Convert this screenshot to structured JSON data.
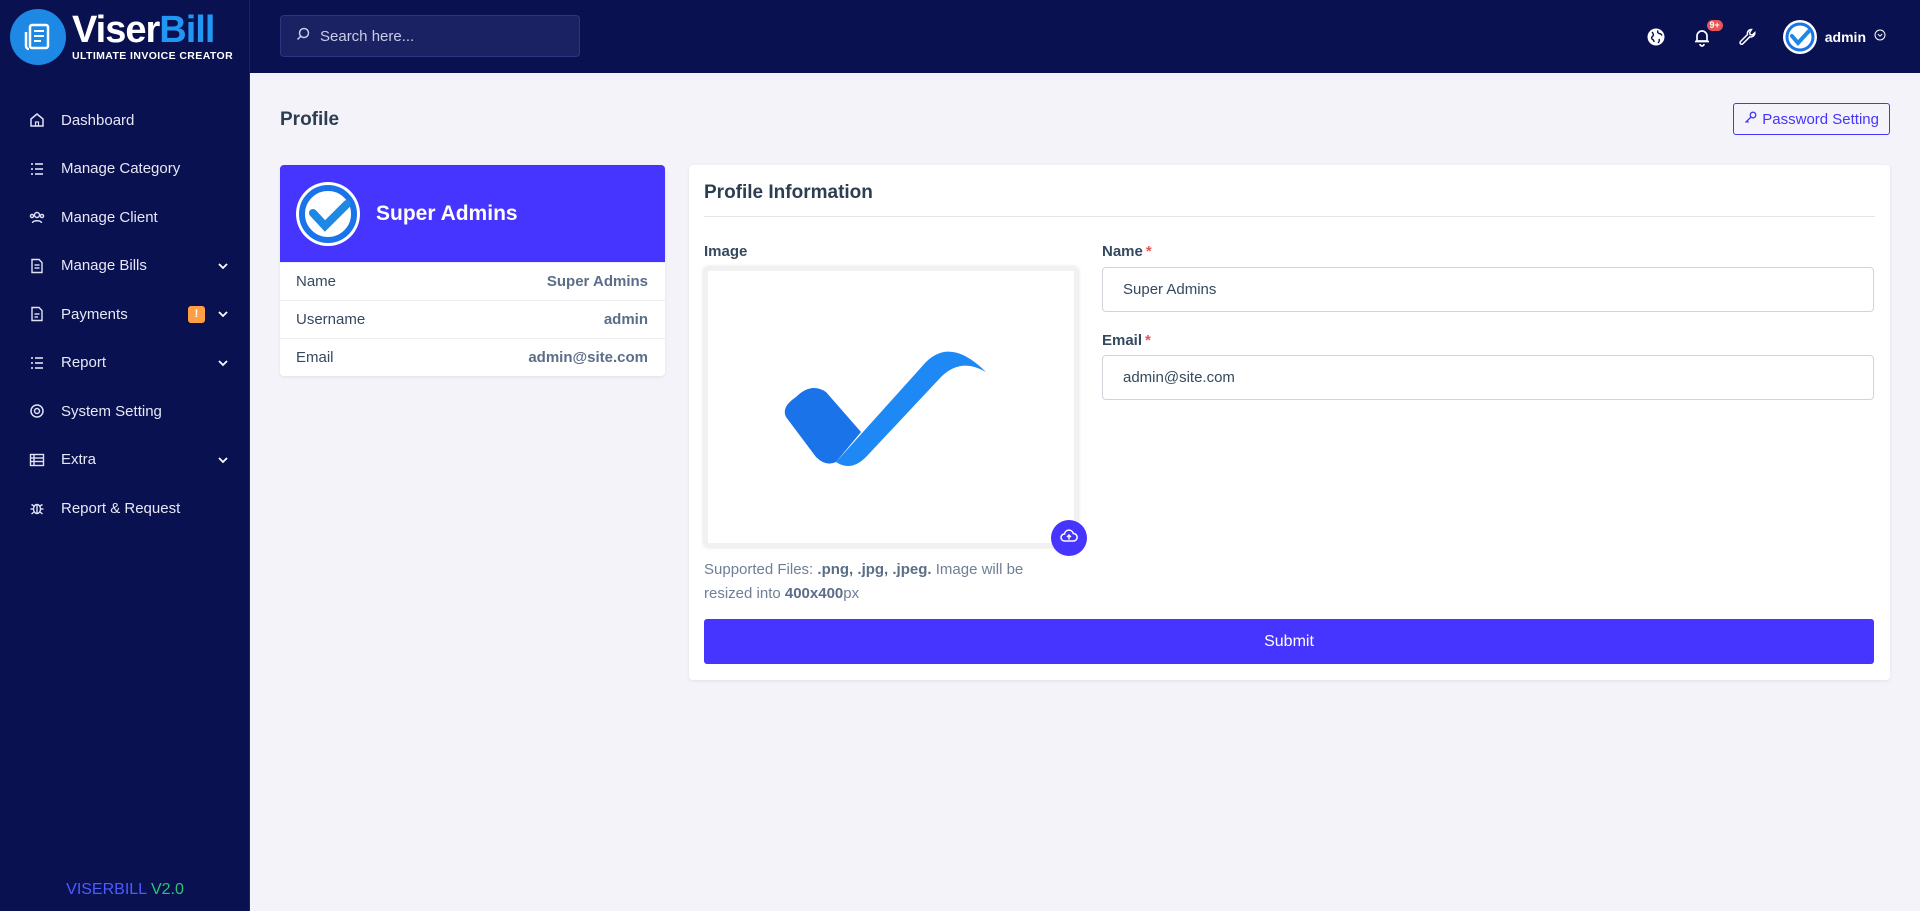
{
  "brand": {
    "name_part1": "Viser",
    "name_part2": "Bill",
    "tagline": "ULTIMATE INVOICE CREATOR"
  },
  "search": {
    "placeholder": "Search here..."
  },
  "topbar": {
    "notification_count": "9+",
    "user_name": "admin"
  },
  "sidebar": {
    "items": [
      {
        "label": "Dashboard",
        "icon": "home-icon"
      },
      {
        "label": "Manage Category",
        "icon": "list-icon"
      },
      {
        "label": "Manage Client",
        "icon": "users-icon"
      },
      {
        "label": "Manage Bills",
        "icon": "invoice-icon",
        "has_submenu": true
      },
      {
        "label": "Payments",
        "icon": "payment-icon",
        "badge": "!",
        "has_submenu": true
      },
      {
        "label": "Report",
        "icon": "report-icon",
        "has_submenu": true
      },
      {
        "label": "System Setting",
        "icon": "settings-icon"
      },
      {
        "label": "Extra",
        "icon": "extra-icon",
        "has_submenu": true
      },
      {
        "label": "Report & Request",
        "icon": "bug-icon"
      }
    ],
    "version_name": "VISERBILL",
    "version_number": "V2.0"
  },
  "page": {
    "title": "Profile",
    "password_button": "Password Setting"
  },
  "profile_card": {
    "name": "Super Admins",
    "rows": [
      {
        "label": "Name",
        "value": "Super Admins"
      },
      {
        "label": "Username",
        "value": "admin"
      },
      {
        "label": "Email",
        "value": "admin@site.com"
      }
    ]
  },
  "form": {
    "title": "Profile Information",
    "image_label": "Image",
    "help_prefix": "Supported Files: ",
    "help_files": ".png, .jpg, .jpeg.",
    "help_mid": " Image will be resized into ",
    "help_size": "400x400",
    "help_suffix": "px",
    "name_label": "Name",
    "name_value": "Super Admins",
    "email_label": "Email",
    "email_value": "admin@site.com",
    "required_mark": "*",
    "submit_label": "Submit"
  },
  "colors": {
    "primary": "#4634ff",
    "sidebar": "#0a1150",
    "warning": "#ff9f43",
    "success": "#28c76f",
    "danger": "#ea5455"
  }
}
